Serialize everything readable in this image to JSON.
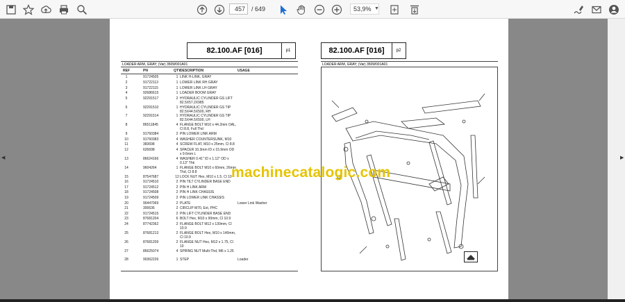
{
  "toolbar": {
    "page_current": "457",
    "page_total": "/ 649",
    "zoom": "53,9%",
    "icons": [
      "save-icon",
      "bookmark-star-icon",
      "upload-icon",
      "print-icon",
      "zoom-search-icon",
      "page-up-icon",
      "page-down-icon",
      "cursor-arrow-icon",
      "hand-icon",
      "zoom-out-icon",
      "zoom-in-icon",
      "fit-page-icon",
      "scroll-mode-icon",
      "sign-icon",
      "email-icon",
      "user-icon"
    ]
  },
  "page1": {
    "code": "82.100.AF [016]",
    "page_label": "p1",
    "subtitle": "LOADER ARM, GRAY; (Var) 350W001A01",
    "headers": {
      "ref": "REF",
      "pn": "PN",
      "qty": "QTY",
      "description": "DESCRIPTION",
      "usage": "USAGE"
    },
    "rows": [
      {
        "ref": "1",
        "pn": "91724505",
        "qty": "1",
        "description": "LINK H-LINK, GRAY",
        "usage": ""
      },
      {
        "ref": "2",
        "pn": "91722113",
        "qty": "1",
        "description": "LOWER LINK RH GRAY",
        "usage": ""
      },
      {
        "ref": "3",
        "pn": "91722115",
        "qty": "1",
        "description": "LOWER LINK LH GRAY",
        "usage": ""
      },
      {
        "ref": "4",
        "pn": "92686615",
        "qty": "1",
        "description": "LOADER BOOM GRAY",
        "usage": ""
      },
      {
        "ref": "5",
        "pn": "92291517",
        "qty": "2",
        "description": "HYDRAULIC CYLINDER GS LIFT 82.5X57.2X985",
        "usage": ""
      },
      {
        "ref": "6",
        "pn": "92291510",
        "qty": "1",
        "description": "HYDRAULIC CYLINDER GS TIP 82.5X44.5X500, RH",
        "usage": ""
      },
      {
        "ref": "7",
        "pn": "92291514",
        "qty": "1",
        "description": "HYDRAULIC CYLINDER GS TIP 82.5X44.5X500, LH",
        "usage": ""
      },
      {
        "ref": "8",
        "pn": "86511845",
        "qty": "4",
        "description": "FLANGE BOLT M10 x 44.2mm OAL, Cl 8.8, Full Thd",
        "usage": ""
      },
      {
        "ref": "9",
        "pn": "91760384",
        "qty": "2",
        "description": "PIN LOWER LINK ARM",
        "usage": ""
      },
      {
        "ref": "10",
        "pn": "91760383",
        "qty": "4",
        "description": "WASHER COUNTERSUNK, M10",
        "usage": ""
      },
      {
        "ref": "11",
        "pn": "383698",
        "qty": "4",
        "description": "SCREW FLAT, M10 x 25mm, Cl 8.8",
        "usage": ""
      },
      {
        "ref": "12",
        "pn": "626698",
        "qty": "4",
        "description": "SPACER 10.3mm ID x 15.9mm OD x 9.6mm L",
        "usage": ""
      },
      {
        "ref": "13",
        "pn": "86624166",
        "qty": "4",
        "description": "WASHER 0.41\" ID x 1.12\" OD x 0.13\" Thk",
        "usage": ""
      },
      {
        "ref": "14",
        "pn": "9604264",
        "qty": "1",
        "description": "FLANGE BOLT M10 x 60mm, 26mm Thd, Cl 8.8",
        "usage": ""
      },
      {
        "ref": "15",
        "pn": "87547687",
        "qty": "12",
        "description": "LOCK NUT Hex, M10 x 1.5, Cl 10",
        "usage": ""
      },
      {
        "ref": "16",
        "pn": "91724510",
        "qty": "2",
        "description": "PIN TILT CYLINDER BASE END",
        "usage": ""
      },
      {
        "ref": "17",
        "pn": "91724512",
        "qty": "2",
        "description": "PIN H LINK ARM",
        "usage": ""
      },
      {
        "ref": "18",
        "pn": "91724508",
        "qty": "2",
        "description": "PIN H LINK CHASSIS",
        "usage": ""
      },
      {
        "ref": "19",
        "pn": "91724509",
        "qty": "2",
        "description": "PIN LOWER LINK CHASSIS",
        "usage": ""
      },
      {
        "ref": "20",
        "pn": "90447069",
        "qty": "2",
        "description": "PLATE",
        "usage": "Lower Link Washer"
      },
      {
        "ref": "21",
        "pn": "300636",
        "qty": "2",
        "description": "CIRCLIP M70, Ext, PHC",
        "usage": ""
      },
      {
        "ref": "22",
        "pn": "91724515",
        "qty": "2",
        "description": "PIN LIFT CYLINDER BASE END",
        "usage": ""
      },
      {
        "ref": "23",
        "pn": "87681204",
        "qty": "6",
        "description": "BOLT Hex, M10 x 90mm, Cl 10.9",
        "usage": ""
      },
      {
        "ref": "24",
        "pn": "87742362",
        "qty": "2",
        "description": "FLANGE BOLT M12 x 130mm, Cl 10.9",
        "usage": ""
      },
      {
        "ref": "25",
        "pn": "87681213",
        "qty": "2",
        "description": "FLANGE BOLT Hex, M10 x 140mm, Cl 10.9",
        "usage": ""
      },
      {
        "ref": "26",
        "pn": "87681209",
        "qty": "2",
        "description": "FLANGE NUT Hex, M12 x 1.75, Cl 10",
        "usage": ""
      },
      {
        "ref": "27",
        "pn": "86625074",
        "qty": "4",
        "description": "SPRING NUT Multi-Thd, M6 x 1.25",
        "usage": ""
      },
      {
        "ref": "28",
        "pn": "90362226",
        "qty": "1",
        "description": "STEP",
        "usage": "Loader"
      }
    ]
  },
  "page2": {
    "code": "82.100.AF [016]",
    "page_label": "p2",
    "subtitle": "LOADER ARM, GRAY; (Var) 350W001A01"
  },
  "watermark": "machinecatalogic.com"
}
